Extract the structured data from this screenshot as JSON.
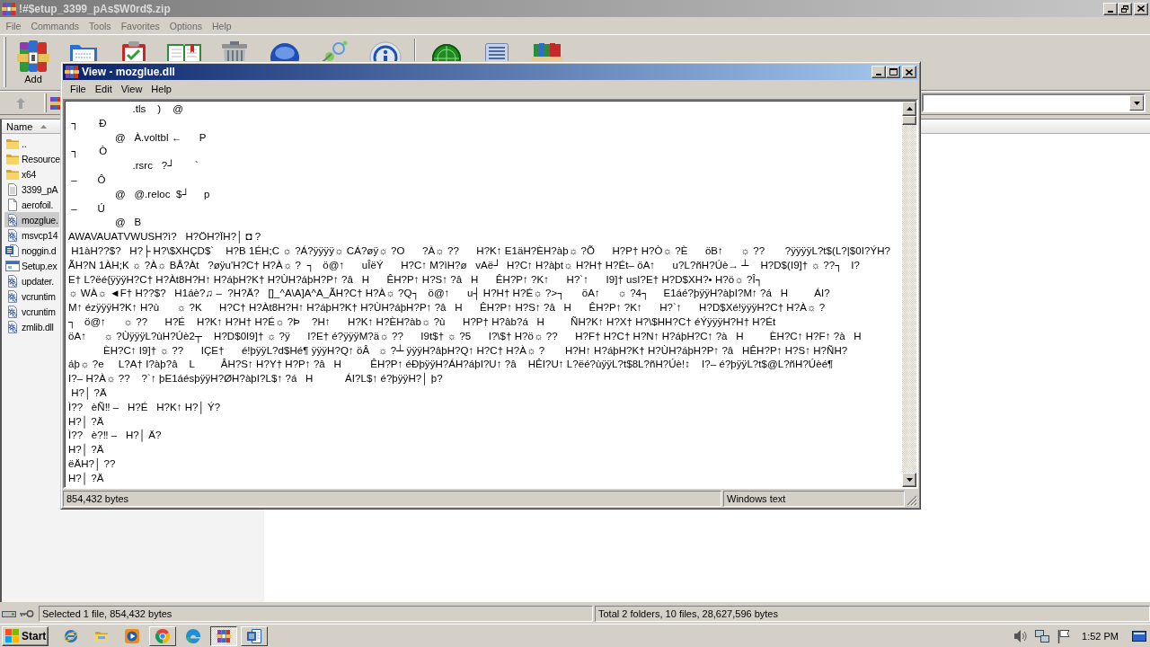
{
  "window": {
    "title": "!#$etup_3399_pAs$W0rd$.zip"
  },
  "menu": [
    "File",
    "Commands",
    "Tools",
    "Favorites",
    "Options",
    "Help"
  ],
  "toolbar": {
    "buttons": [
      {
        "label": "Add"
      }
    ]
  },
  "file_list": {
    "columns": [
      {
        "label": "Name",
        "sorted": true
      }
    ],
    "rows": [
      {
        "name": "..",
        "kind": "folder",
        "selected": false
      },
      {
        "name": "Resource",
        "kind": "folder",
        "selected": false
      },
      {
        "name": "x64",
        "kind": "folder",
        "selected": false
      },
      {
        "name": "3399_pA",
        "kind": "text",
        "selected": false
      },
      {
        "name": "aerofoil.",
        "kind": "blank",
        "selected": false
      },
      {
        "name": "mozglue.",
        "kind": "library",
        "selected": true
      },
      {
        "name": "msvcp14",
        "kind": "library",
        "selected": false
      },
      {
        "name": "noggin.d",
        "kind": "document",
        "selected": false
      },
      {
        "name": "Setup.ex",
        "kind": "program",
        "selected": false
      },
      {
        "name": "updater.",
        "kind": "library",
        "selected": false
      },
      {
        "name": "vcruntim",
        "kind": "library",
        "selected": false
      },
      {
        "name": "vcruntim",
        "kind": "library",
        "selected": false
      },
      {
        "name": "zmlib.dll",
        "kind": "library",
        "selected": false
      }
    ]
  },
  "status_bar": [
    "Selected 1 file, 854,432 bytes",
    "Total 2 folders, 10 files, 28,627,596 bytes"
  ],
  "viewer": {
    "title": "View - mozglue.dll",
    "menu": [
      "File",
      "Edit",
      "View",
      "Help"
    ],
    "lines": [
      "                      .tls    )    @",
      " ┐       Ð",
      "                @   À.voltbl ←      P",
      " ┐       Ò",
      "                      .rsrc   ?┘       `",
      " –       Ô",
      "                @   @.reloc  $┘     p",
      " –       Ú",
      "                @   B",
      "AWAVAUATVWUSH?ì?   H?ÖH?ÏH?│ ◘ ?",
      " H1àH??$?   H?├ H?\\$XHÇD$`    H?B 1ÉH;C ☼ ?Á?ÿÿÿÿ☼ CÁ?øÿ☼ ?O      ?À☼ ??      H?K↑ E1äH?ÈH?àþ☼ ?Õ      H?P† H?Ò☼ ?È      öB↑      ☼ ??       ?ÿÿÿÿL?t$(L?|$0I?ÝH?",
      "ÃH?N 1ÀH;K ☼ ?À☼ BÅ?Àt   ?øÿu'H?C† H?À☼ ?  ┐   ö@↑      uÎëÝ      H?C↑ M?ìH?ø   vAë┘  H?C↑ H?àþt☼ H?H† H?Ét– öA↑      u?L?ñH?Úè→ ┴    H?D$(I9]† ☼ ??┐   I?",
      "E† L?ëé{ÿÿÿH?C† H?Àt8H?H↑ H?áþH?K† H?ÙH?áþH?P↑ ?â   H      ÊH?P↑ H?S↑ ?â   H      ÊH?P↑ ?K↑      H?`↑      I9]† usI?E† H?D$XH?• H?ö☼ ?Î┐",
      "☼ WÀ☼ ◄F† H??$?   H1áè?♫ –  ?H?Ä?   []_^A\\A]A^A_ÃH?C† H?À☼ ?Q┐   ö@↑      u┤ H?H† H?É☼ ?>┐      öA↑      ☼ ?4┐     E1áé?þÿÿH?àþI?M↑ ?á   H         ÁI?",
      "M↑ ézÿÿÿH?K↑ H?ù      ☼ ?K      H?C† H?Àt8H?H↑ H?áþH?K† H?ÙH?áþH?P↑ ?â   H      ÊH?P↑ H?S↑ ?â   H      ÊH?P↑ ?K↑      H?`↑      H?D$Xé!ÿÿÿH?C† H?À☼ ?",
      "┐   ö@↑      ☼ ??      H?É    H?K↑ H?H† H?É☼ ?Þ    ?H↑      H?K↑ H?ÈH?àb☼ ?ù      H?P† H?âb?á   H         ÑH?K↑ H?X† H?\\$HH?C† éÝÿÿÿH?H† H?Ét",
      "öA↑      ☼ ?ÙÿÿÿL?ùH?Úè2┬    H?D$0I9]† ☼ ?ÿ      I?E† é?ÿÿÿM?ä☼ ??      I9t$† ☼ ?5      I?\\$† H?ö☼ ??      H?F† H?C† H?N↑ H?áþH?C↑ ?à   H         ÈH?C↑ H?F↑ ?à   H",
      "            ÈH?C↑ I9]† ☼ ??      IÇE†      é!þÿÿL?d$Hé¶ ÿÿÿH?Q↑ öÂ   ☼ ?┴ ÿÿÿH?âþH?Q↑ H?C† H?À☼ ?       H?H↑ H?áþH?K† H?ÙH?áþH?P↑ ?â   HÊH?P↑ H?S↑ H?ÑH?",
      "áþ☼ ?e     L?A† I?àþ?â    L         ÂH?S↑ H?Y† H?P↑ ?â   H          ÊH?P↑ éÐþÿÿH?ÁH?áþI?U↑ ?â    HÊI?U↑ L?ëé?ùÿÿL?t$8L?ñH?Úè!↕    I?– é?þÿÿL?t$@L?ñH?Úèé¶",
      "I?– H?À☼ ??    ?`↑ þE1áésþÿÿH?ØH?àþI?L$↑ ?á   H           ÁI?L$↑ é?þÿÿH?│ þ?",
      " H?│ ?Ä",
      "Ì??   èÑ‼ –   H?É   H?K↑ H?│ Ý?",
      "H?│ ?Ä",
      "Ì??   è?‼ –   H?│ Ä?",
      "H?│ ?Ä",
      "ëÄH?│ ??",
      "H?│ ?Ä"
    ],
    "status_bar": [
      "854,432 bytes",
      "Windows text"
    ]
  },
  "taskbar": {
    "start": "Start",
    "apps": [
      {
        "kind": "globe",
        "open": false,
        "selected": false
      },
      {
        "kind": "folder",
        "open": false,
        "selected": false
      },
      {
        "kind": "player",
        "open": false,
        "selected": false
      },
      {
        "kind": "circle",
        "open": true,
        "selected": false
      },
      {
        "kind": "swirl",
        "open": false,
        "selected": false
      },
      {
        "kind": "books",
        "open": true,
        "selected": true
      },
      {
        "kind": "document",
        "open": true,
        "selected": false
      }
    ],
    "clock": "1:52 PM"
  }
}
